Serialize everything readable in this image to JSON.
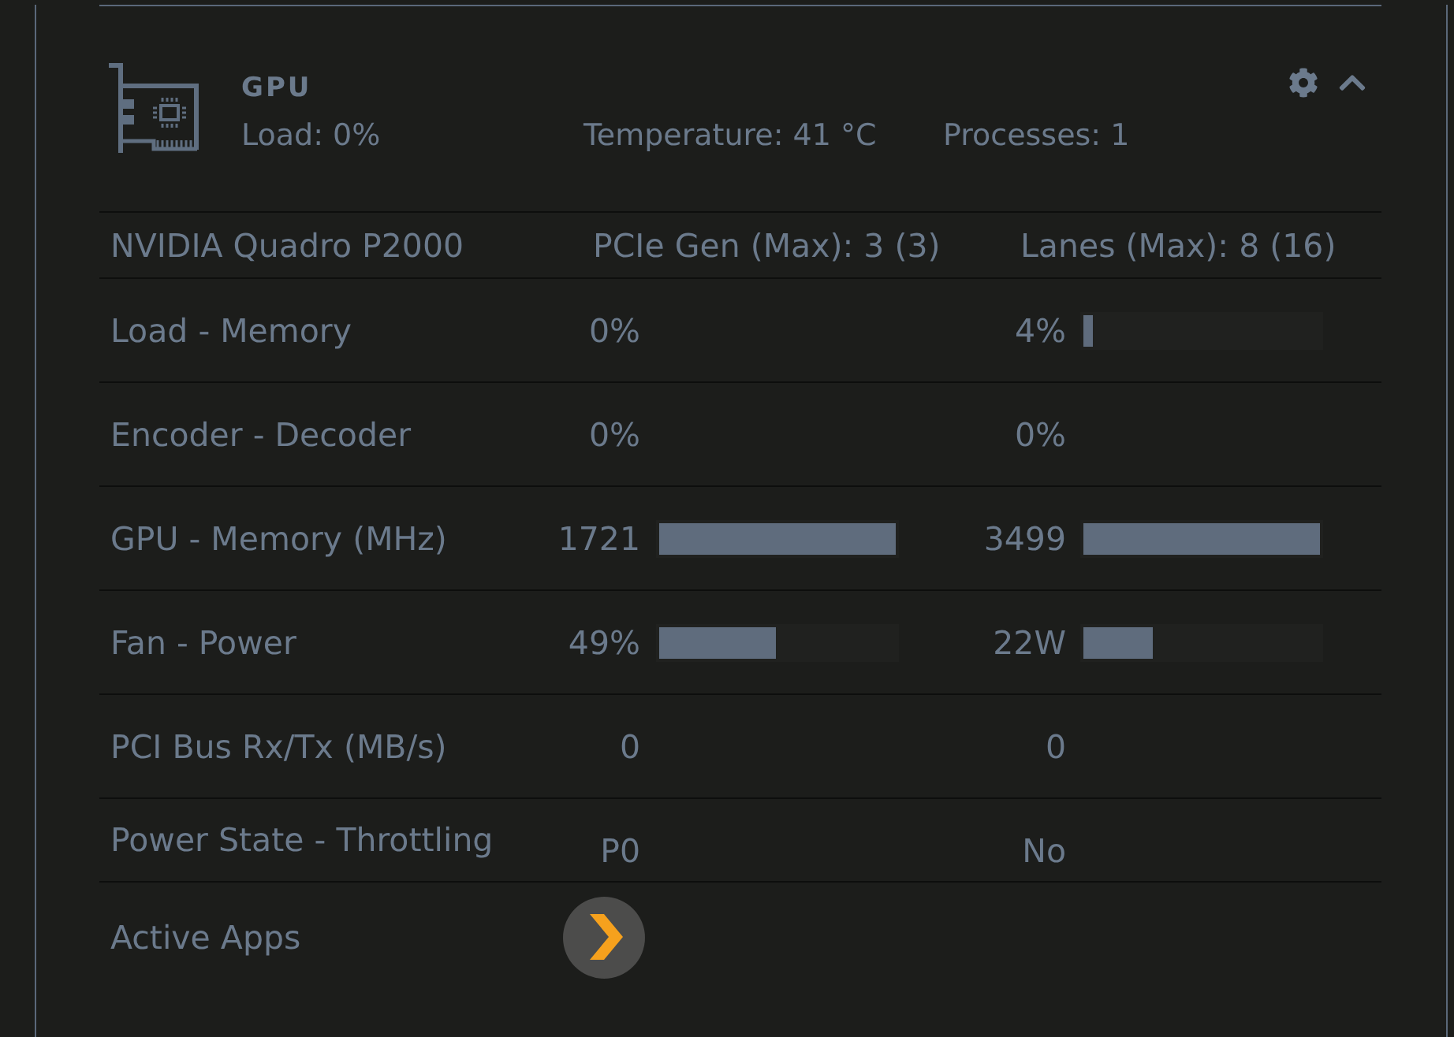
{
  "card": {
    "title": "GPU",
    "load": "Load: 0%",
    "temperature": "Temperature: 41 °C",
    "processes": "Processes: 1",
    "expanded": true
  },
  "device": {
    "name": "NVIDIA Quadro P2000",
    "pcie": "PCIe Gen (Max): 3 (3)",
    "lanes": "Lanes (Max): 8 (16)"
  },
  "rows": [
    {
      "kind": "metric",
      "label": "Load - Memory",
      "values": [
        {
          "text": "0%"
        },
        {
          "text": "4%",
          "level": 0.04
        }
      ]
    },
    {
      "kind": "metric",
      "label": "Encoder - Decoder",
      "values": [
        {
          "text": "0%"
        },
        {
          "text": "0%"
        }
      ]
    },
    {
      "kind": "metric",
      "label": "GPU - Memory (MHz)",
      "values": [
        {
          "text": "1721",
          "level": 1.0
        },
        {
          "text": "3499",
          "level": 1.0
        }
      ]
    },
    {
      "kind": "metric",
      "label": "Fan - Power",
      "values": [
        {
          "text": "49%",
          "level": 0.49
        },
        {
          "text": "22W",
          "level": 0.29
        }
      ]
    },
    {
      "kind": "metric",
      "label": "PCI Bus Rx/Tx (MB/s)",
      "values": [
        {
          "text": "0"
        },
        {
          "text": "0"
        }
      ]
    },
    {
      "kind": "state",
      "label": "Power State - Throttling",
      "values": [
        {
          "text": "P0"
        },
        {
          "text": "No"
        }
      ]
    },
    {
      "kind": "apps",
      "label": "Active Apps"
    }
  ]
}
